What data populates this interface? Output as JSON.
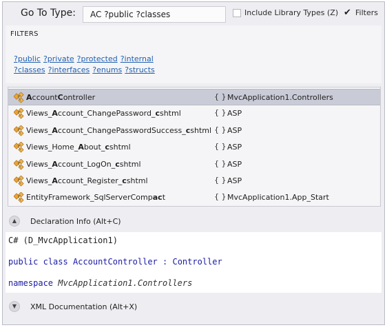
{
  "header": {
    "goto_label": "Go To Type:",
    "search_value": "AC  ?public ?classes",
    "include_library_label": "Include Library Types (Z)",
    "include_library_checked": false,
    "filters_label": "Filters",
    "filters_checked": true
  },
  "filters": {
    "title": "FILTERS",
    "row1": [
      "?public",
      "?private",
      "?protected",
      "?internal"
    ],
    "row2": [
      "?classes",
      "?interfaces",
      "?enums",
      "?structs"
    ]
  },
  "results": [
    {
      "pre": "",
      "bold": "A",
      "mid": "ccount",
      "bold2": "C",
      "post": "ontroller",
      "namespace": "MvcApplication1.Controllers",
      "selected": true
    },
    {
      "pre": "Views_",
      "bold": "A",
      "mid": "ccount_ChangePassword_",
      "bold2": "c",
      "post": "shtml",
      "namespace": "ASP",
      "selected": false
    },
    {
      "pre": "Views_",
      "bold": "A",
      "mid": "ccount_ChangePasswordSuccess_",
      "bold2": "c",
      "post": "shtml",
      "namespace": "ASP",
      "selected": false
    },
    {
      "pre": "Views_Home_",
      "bold": "A",
      "mid": "bout_",
      "bold2": "c",
      "post": "shtml",
      "namespace": "ASP",
      "selected": false
    },
    {
      "pre": "Views_",
      "bold": "A",
      "mid": "ccount_LogOn_",
      "bold2": "c",
      "post": "shtml",
      "namespace": "ASP",
      "selected": false
    },
    {
      "pre": "Views_",
      "bold": "A",
      "mid": "ccount_Register_",
      "bold2": "c",
      "post": "shtml",
      "namespace": "ASP",
      "selected": false
    },
    {
      "pre": "EntityFramework_SqlServerComp",
      "bold": "a",
      "mid": "",
      "bold2": "c",
      "post": "t",
      "namespace": "MvcApplication1.App_Start",
      "selected": false
    }
  ],
  "namespace_glyph": "{ }",
  "declaration": {
    "label": "Declaration Info (Alt+C)",
    "expander_glyph": "▲",
    "line1": "C# (D_MvcApplication1)",
    "line2_kw1": "public",
    "line2_kw2": "class",
    "line2_type": "AccountController",
    "line2_colon": ":",
    "line2_base": "Controller",
    "line3_kw": "namespace",
    "line3_ns": "MvcApplication1.Controllers"
  },
  "xml_doc": {
    "label": "XML Documentation (Alt+X)",
    "expander_glyph": "▼"
  },
  "colors": {
    "link": "#1e5fb0",
    "keyword": "#1a1aa6",
    "selection": "#c9cbd6",
    "icon_orange": "#e8a33a"
  },
  "icon_names": {
    "result": "class-icon",
    "namespace": "namespace-braces-icon"
  }
}
